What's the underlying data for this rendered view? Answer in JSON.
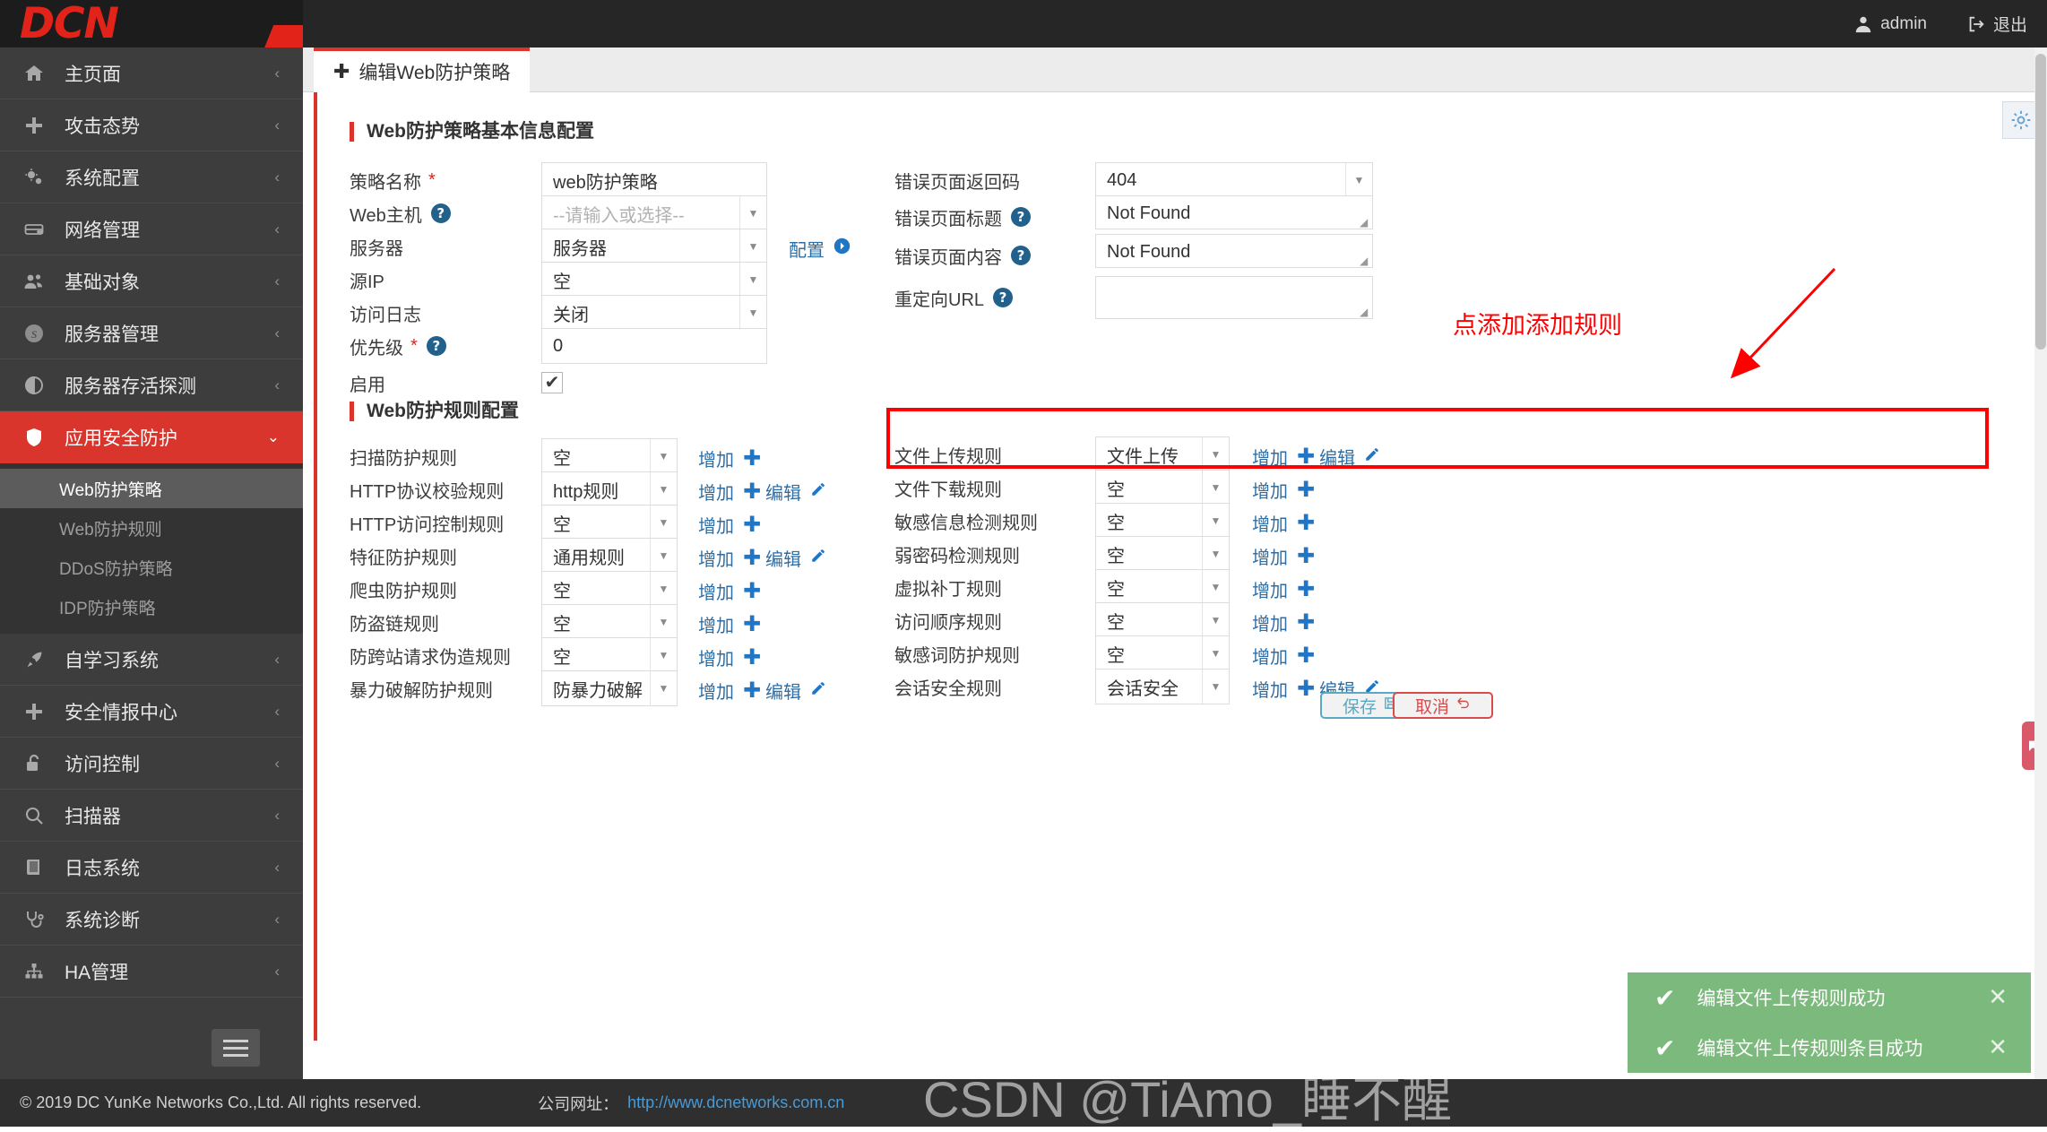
{
  "topbar": {
    "logo_text": "DCN",
    "user_label": "admin",
    "logout_label": "退出"
  },
  "sidebar": {
    "items": [
      {
        "label": "主页面",
        "icon": "home-icon",
        "chevron": "‹"
      },
      {
        "label": "攻击态势",
        "icon": "plus-icon",
        "chevron": "‹"
      },
      {
        "label": "系统配置",
        "icon": "gears-icon",
        "chevron": "‹"
      },
      {
        "label": "网络管理",
        "icon": "server-icon",
        "chevron": "‹"
      },
      {
        "label": "基础对象",
        "icon": "users-icon",
        "chevron": "‹"
      },
      {
        "label": "服务器管理",
        "icon": "skype-icon",
        "chevron": "‹"
      },
      {
        "label": "服务器存活探测",
        "icon": "contrast-icon",
        "chevron": "‹"
      },
      {
        "label": "应用安全防护",
        "icon": "shield-icon",
        "chevron": "⌄",
        "active": true
      },
      {
        "label": "自学习系统",
        "icon": "rocket-icon",
        "chevron": "‹"
      },
      {
        "label": "安全情报中心",
        "icon": "plus-icon",
        "chevron": "‹"
      },
      {
        "label": "访问控制",
        "icon": "lock-open-icon",
        "chevron": "‹"
      },
      {
        "label": "扫描器",
        "icon": "search-icon",
        "chevron": "‹"
      },
      {
        "label": "日志系统",
        "icon": "book-icon",
        "chevron": "‹"
      },
      {
        "label": "系统诊断",
        "icon": "stethoscope-icon",
        "chevron": "‹"
      },
      {
        "label": "HA管理",
        "icon": "sitemap-icon",
        "chevron": "‹"
      }
    ],
    "subitems": [
      {
        "label": "Web防护策略",
        "selected": true
      },
      {
        "label": "Web防护规则",
        "selected": false
      },
      {
        "label": "DDoS防护策略",
        "selected": false
      },
      {
        "label": "IDP防护策略",
        "selected": false
      }
    ]
  },
  "tab": {
    "label": "编辑Web防护策略",
    "plus": "✚"
  },
  "sections": {
    "basic_title": "Web防护策略基本信息配置",
    "rules_title": "Web防护规则配置"
  },
  "basic_left": [
    {
      "label": "策略名称",
      "required": true,
      "help": false,
      "type": "input",
      "value": "web防护策略"
    },
    {
      "label": "Web主机",
      "required": false,
      "help": true,
      "type": "select",
      "value": "",
      "placeholder": "--请输入或选择--"
    },
    {
      "label": "服务器",
      "required": false,
      "help": false,
      "type": "select",
      "value": "服务器",
      "link": "配置"
    },
    {
      "label": "源IP",
      "required": false,
      "help": false,
      "type": "select",
      "value": "空"
    },
    {
      "label": "访问日志",
      "required": false,
      "help": false,
      "type": "select",
      "value": "关闭"
    },
    {
      "label": "优先级",
      "required": true,
      "help": true,
      "type": "input",
      "value": "0"
    },
    {
      "label": "启用",
      "required": false,
      "help": false,
      "type": "checkbox",
      "checked": true
    }
  ],
  "basic_right": [
    {
      "label": "错误页面返回码",
      "help": false,
      "type": "select",
      "value": "404"
    },
    {
      "label": "错误页面标题",
      "help": true,
      "type": "textarea",
      "value": "Not Found"
    },
    {
      "label": "错误页面内容",
      "help": true,
      "type": "textarea",
      "value": "Not Found"
    },
    {
      "label": "重定向URL",
      "help": true,
      "type": "textarea",
      "value": ""
    }
  ],
  "rules_left": [
    {
      "label": "扫描防护规则",
      "value": "空",
      "add": "增加",
      "edit": null
    },
    {
      "label": "HTTP协议校验规则",
      "value": "http规则",
      "add": "增加",
      "edit": "编辑"
    },
    {
      "label": "HTTP访问控制规则",
      "value": "空",
      "add": "增加",
      "edit": null
    },
    {
      "label": "特征防护规则",
      "value": "通用规则",
      "add": "增加",
      "edit": "编辑"
    },
    {
      "label": "爬虫防护规则",
      "value": "空",
      "add": "增加",
      "edit": null
    },
    {
      "label": "防盗链规则",
      "value": "空",
      "add": "增加",
      "edit": null
    },
    {
      "label": "防跨站请求伪造规则",
      "value": "空",
      "add": "增加",
      "edit": null
    },
    {
      "label": "暴力破解防护规则",
      "value": "防暴力破解",
      "add": "增加",
      "edit": "编辑"
    }
  ],
  "rules_right": [
    {
      "label": "文件上传规则",
      "value": "文件上传",
      "add": "增加",
      "edit": "编辑",
      "highlighted": true
    },
    {
      "label": "文件下载规则",
      "value": "空",
      "add": "增加",
      "edit": null
    },
    {
      "label": "敏感信息检测规则",
      "value": "空",
      "add": "增加",
      "edit": null
    },
    {
      "label": "弱密码检测规则",
      "value": "空",
      "add": "增加",
      "edit": null
    },
    {
      "label": "虚拟补丁规则",
      "value": "空",
      "add": "增加",
      "edit": null
    },
    {
      "label": "访问顺序规则",
      "value": "空",
      "add": "增加",
      "edit": null
    },
    {
      "label": "敏感词防护规则",
      "value": "空",
      "add": "增加",
      "edit": null
    },
    {
      "label": "会话安全规则",
      "value": "会话安全",
      "add": "增加",
      "edit": "编辑"
    }
  ],
  "annotation": {
    "text": "点添加添加规则",
    "color": "#fe0000"
  },
  "buttons": {
    "save": "保存",
    "cancel": "取消"
  },
  "toasts": [
    {
      "message": "编辑文件上传规则成功"
    },
    {
      "message": "编辑文件上传规则条目成功"
    }
  ],
  "footer": {
    "copyright": "© 2019 DC YunKe Networks Co.,Ltd. All rights reserved.",
    "company_label": "公司网址：",
    "company_url": "http://www.dcnetworks.com.cn"
  },
  "watermark": "CSDN @TiAmo_睡不醒"
}
